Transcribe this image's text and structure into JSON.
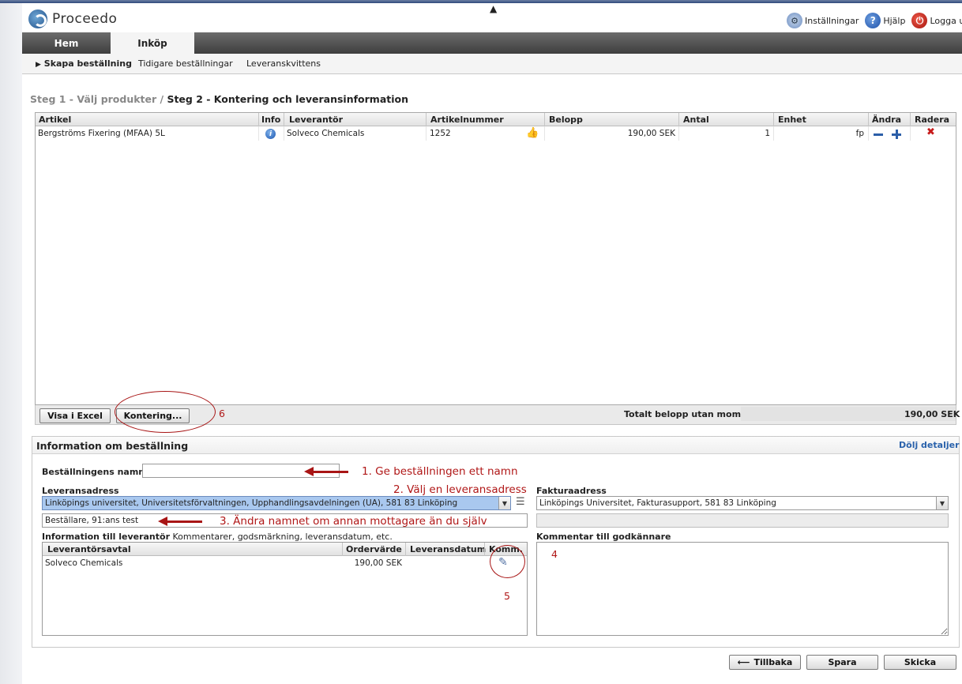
{
  "app": {
    "name": "Proceedo"
  },
  "toplinks": {
    "settings": "Inställningar",
    "help": "Hjälp",
    "logout": "Logga ut"
  },
  "tabs": [
    {
      "label": "Hem"
    },
    {
      "label": "Inköp"
    }
  ],
  "subnav": {
    "items": [
      "Skapa beställning",
      "Tidigare beställningar",
      "Leveranskvittens"
    ]
  },
  "breadcrumb": {
    "step1": "Steg 1 - Välj produkter /",
    "step2": "Steg 2 - Kontering och leveransinformation"
  },
  "grid": {
    "columns": [
      "Artikel",
      "Info",
      "Leverantör",
      "Artikelnummer",
      "Belopp",
      "Antal",
      "Enhet",
      "Ändra",
      "Radera"
    ],
    "rows": [
      {
        "artikel": "Bergströms Fixering (MFAA) 5L",
        "leverantor": "Solveco Chemicals",
        "artikelnummer": "1252",
        "belopp": "190,00 SEK",
        "antal": "1",
        "enhet": "fp"
      }
    ],
    "buttons": {
      "excel": "Visa i Excel",
      "kontering": "Kontering..."
    },
    "total_label": "Totalt belopp utan moms",
    "total_value": "190,00 SEK"
  },
  "info": {
    "title": "Information om beställning",
    "toggle": "Dölj detaljer",
    "name_label": "Beställningens namn",
    "name_value": "",
    "leverans_label": "Leveransadress",
    "leverans_value": "Linköpings universitet, Universitetsförvaltningen, Upphandlingsavdelningen (UA), 581 83 Linköping",
    "recipient_value": "Beställare, 91:ans test",
    "faktura_label": "Fakturaadress",
    "faktura_value": "Linköpings Universitet, Fakturasupport, 581 83 Linköping",
    "faktura_extra": "",
    "sup_label": "Information till leverantör",
    "sup_hint": "Kommentarer, godsmärkning, leveransdatum, etc.",
    "sup_columns": [
      "Leverantörsavtal",
      "Ordervärde",
      "Leveransdatum",
      "Komm."
    ],
    "sup_rows": [
      {
        "avtal": "Solveco Chemicals",
        "ordervarde": "190,00 SEK",
        "leveransdatum": ""
      }
    ],
    "komm_label": "Kommentar till godkännare"
  },
  "annotations": {
    "a1": "1. Ge beställningen ett namn",
    "a2": "2. Välj en leveransadress",
    "a3": "3. Ändra namnet om annan mottagare än du själv",
    "a4": "4",
    "a5": "5",
    "a6": "6"
  },
  "footer": {
    "back": "Tillbaka",
    "save": "Spara",
    "send": "Skicka"
  },
  "icons": {
    "logo": "proceedo-logo-icon",
    "settings": "user-settings-icon",
    "help": "help-icon",
    "logout": "power-icon",
    "info": "info-icon",
    "thumb": "thumbs-up-icon",
    "minus": "minus-icon",
    "plus": "plus-icon",
    "delete": "delete-x-icon",
    "list": "list-icon",
    "comment": "edit-comment-icon",
    "back": "arrow-left-icon"
  },
  "colors": {
    "accent": "#2a62ab",
    "annotation": "#b01717",
    "nav": "#4a4a4a"
  }
}
